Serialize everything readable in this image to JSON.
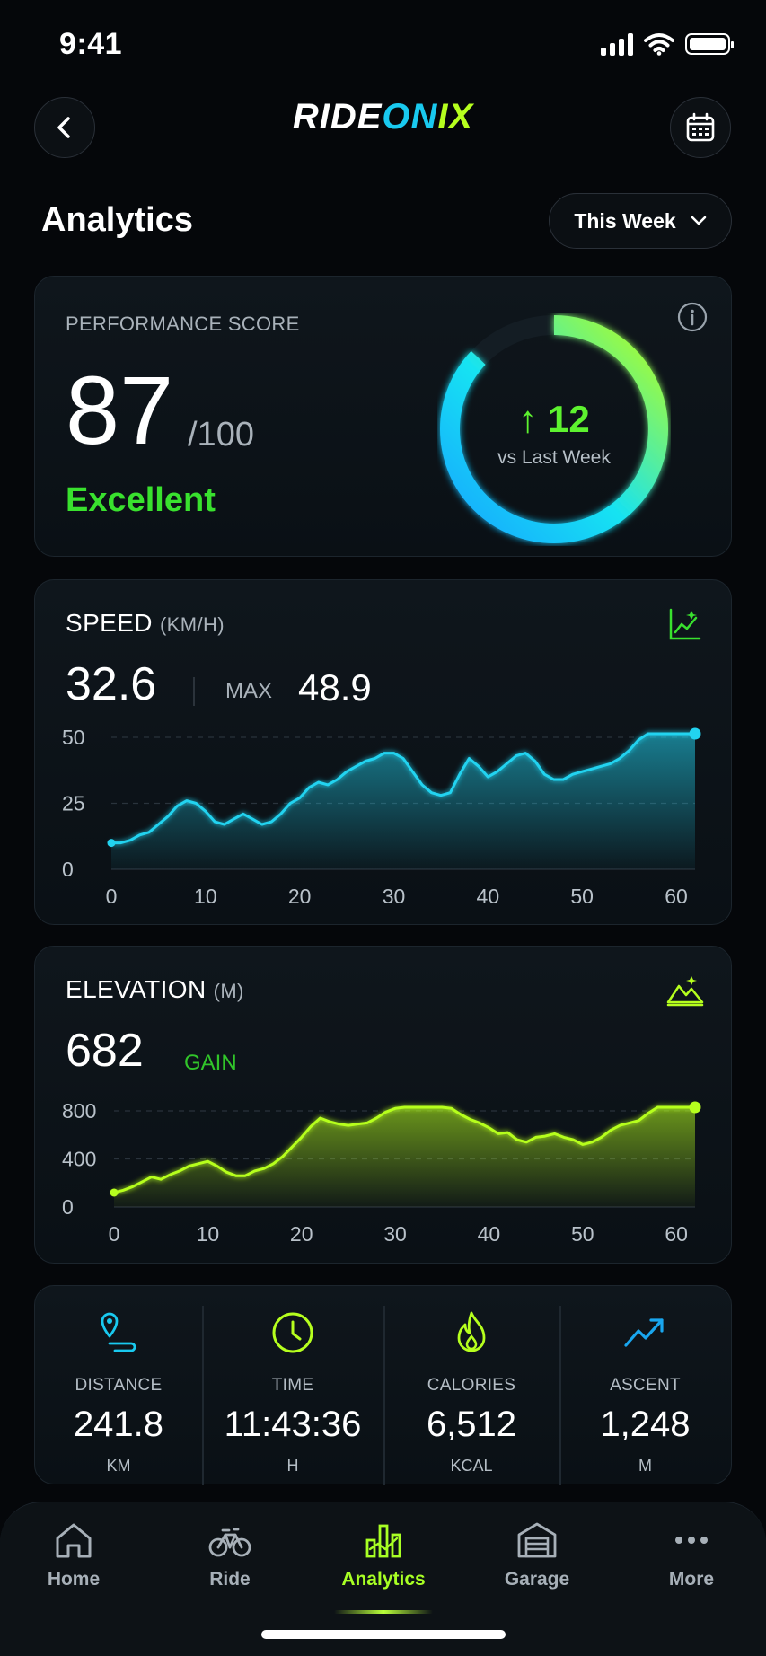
{
  "status_bar": {
    "time": "9:41"
  },
  "header": {
    "logo": {
      "part1": "RIDE",
      "part2": "ON",
      "part3": "IX"
    }
  },
  "page": {
    "title": "Analytics",
    "period": "This Week"
  },
  "performance": {
    "label": "PERFORMANCE SCORE",
    "score": "87",
    "max": "/100",
    "rating": "Excellent",
    "score_fraction": 0.87,
    "delta": "12",
    "delta_label": "vs Last Week"
  },
  "speed": {
    "title": "SPEED",
    "unit": "(KM/H)",
    "value": "32.6",
    "max_label": "MAX",
    "max_value": "48.9"
  },
  "elevation": {
    "title": "ELEVATION",
    "unit": "(M)",
    "value": "682",
    "gain_label": "GAIN"
  },
  "chart_data": [
    {
      "type": "area",
      "title": "SPEED (KM/H)",
      "x": [
        0,
        1,
        2,
        3,
        4,
        5,
        6,
        7,
        8,
        9,
        10,
        11,
        12,
        13,
        14,
        15,
        16,
        17,
        18,
        19,
        20,
        21,
        22,
        23,
        24,
        25,
        26,
        27,
        28,
        29,
        30,
        31,
        32,
        33,
        34,
        35,
        36,
        37,
        38,
        39,
        40,
        41,
        42,
        43,
        44,
        45,
        46,
        47,
        48,
        49,
        50,
        51,
        52,
        53,
        54,
        55,
        56,
        57,
        58,
        59,
        60,
        61,
        62
      ],
      "y": [
        10,
        10,
        11,
        13,
        14,
        17,
        20,
        24,
        26,
        25,
        22,
        18,
        17,
        19,
        21,
        19,
        17,
        18,
        21,
        25,
        27,
        31,
        33,
        32,
        34,
        37,
        39,
        41,
        42,
        44,
        44,
        42,
        37,
        32,
        29,
        28,
        29,
        36,
        42,
        39,
        35,
        37,
        40,
        43,
        44,
        41,
        36,
        34,
        34,
        36,
        37,
        38,
        39,
        40,
        42,
        45,
        49,
        52,
        53,
        56,
        60,
        62,
        62
      ],
      "xlim": [
        0,
        62
      ],
      "ylim": [
        0,
        50
      ],
      "xticks": [
        0,
        10,
        20,
        30,
        40,
        50,
        60
      ],
      "yticks": [
        0,
        25,
        50
      ],
      "color": "#22d3f0"
    },
    {
      "type": "area",
      "title": "ELEVATION (M)",
      "x": [
        0,
        1,
        2,
        3,
        4,
        5,
        6,
        7,
        8,
        9,
        10,
        11,
        12,
        13,
        14,
        15,
        16,
        17,
        18,
        19,
        20,
        21,
        22,
        23,
        24,
        25,
        26,
        27,
        28,
        29,
        30,
        31,
        32,
        33,
        34,
        35,
        36,
        37,
        38,
        39,
        40,
        41,
        42,
        43,
        44,
        45,
        46,
        47,
        48,
        49,
        50,
        51,
        52,
        53,
        54,
        55,
        56,
        57,
        58,
        59,
        60,
        61,
        62
      ],
      "y": [
        120,
        140,
        170,
        210,
        250,
        230,
        270,
        300,
        340,
        360,
        380,
        340,
        290,
        260,
        260,
        300,
        320,
        360,
        420,
        500,
        580,
        670,
        740,
        710,
        690,
        680,
        690,
        700,
        740,
        790,
        820,
        850,
        860,
        870,
        900,
        860,
        820,
        770,
        730,
        700,
        660,
        610,
        620,
        560,
        540,
        580,
        590,
        610,
        580,
        560,
        520,
        540,
        580,
        640,
        680,
        700,
        720,
        780,
        840,
        900,
        880,
        940,
        980
      ],
      "xlim": [
        0,
        62
      ],
      "ylim": [
        0,
        800
      ],
      "xticks": [
        0,
        10,
        20,
        30,
        40,
        50,
        60
      ],
      "yticks": [
        0,
        400,
        800
      ],
      "color": "#b6ff1e"
    }
  ],
  "stats": [
    {
      "label": "DISTANCE",
      "value": "241.8",
      "unit": "KM",
      "icon": "location-route-icon",
      "color": "#19c9ef"
    },
    {
      "label": "TIME",
      "value": "11:43:36",
      "unit": "H",
      "icon": "clock-icon",
      "color": "#b6ff1e"
    },
    {
      "label": "CALORIES",
      "value": "6,512",
      "unit": "KCAL",
      "icon": "flame-icon",
      "color": "#b6ff1e"
    },
    {
      "label": "ASCENT",
      "value": "1,248",
      "unit": "M",
      "icon": "trend-up-icon",
      "color": "#19a6ef"
    }
  ],
  "tabs": [
    {
      "label": "Home",
      "icon": "home-icon"
    },
    {
      "label": "Ride",
      "icon": "bicycle-icon"
    },
    {
      "label": "Analytics",
      "icon": "bar-chart-icon",
      "active": true
    },
    {
      "label": "Garage",
      "icon": "garage-icon"
    },
    {
      "label": "More",
      "icon": "more-icon"
    }
  ]
}
